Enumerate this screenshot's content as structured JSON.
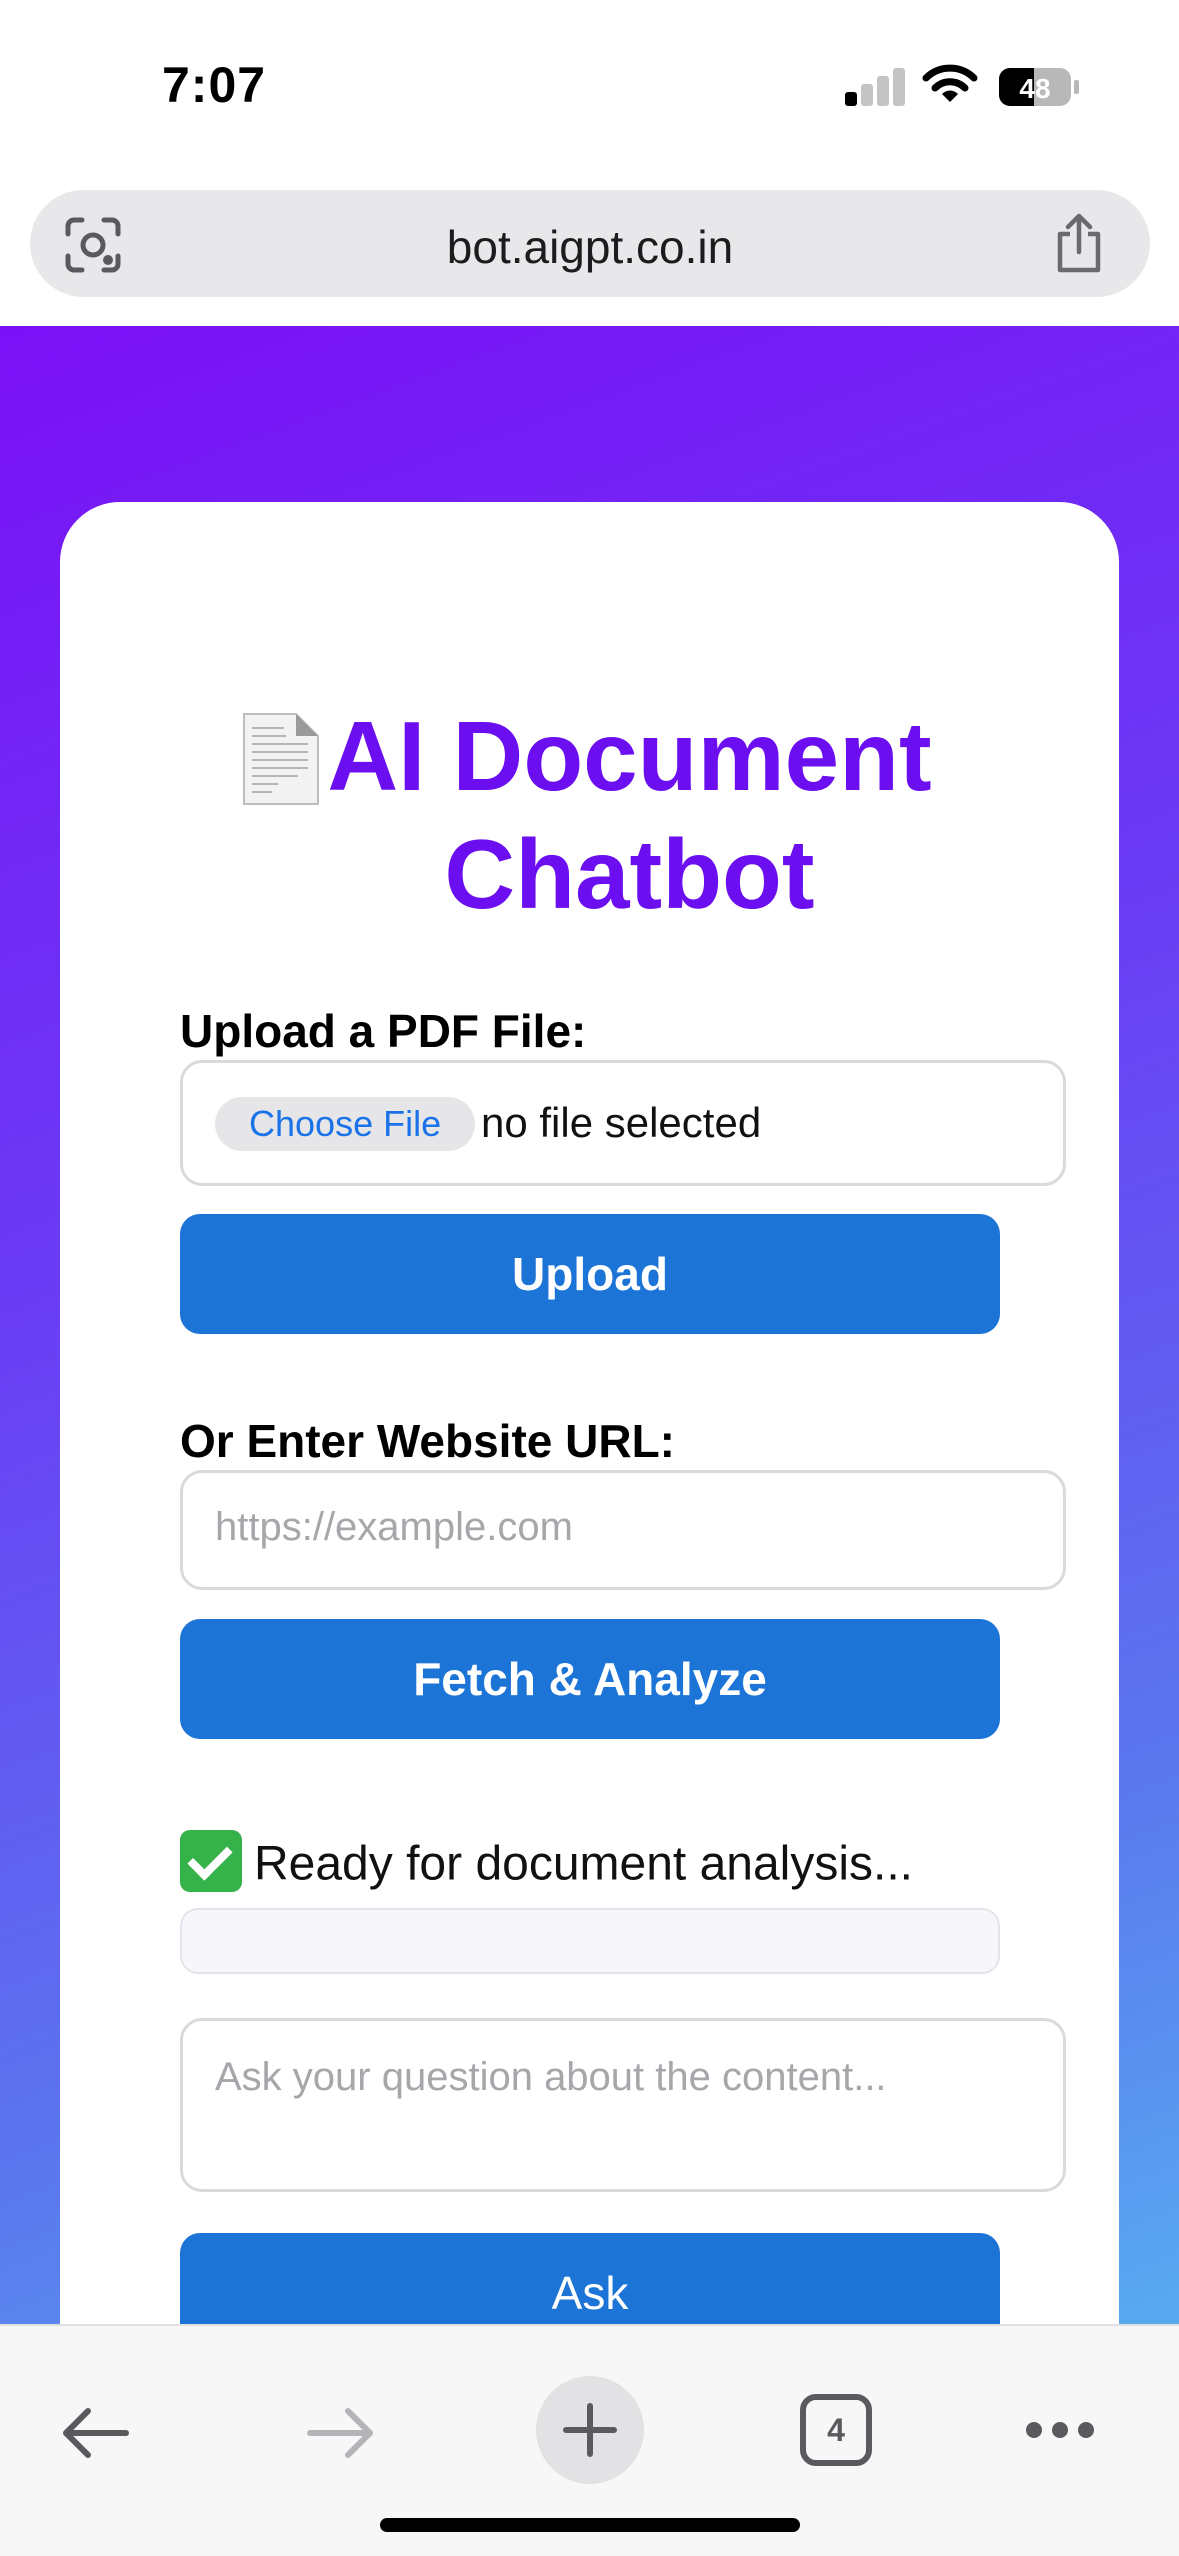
{
  "status_bar": {
    "time": "7:07",
    "battery": "48"
  },
  "browser": {
    "url": "bot.aigpt.co.in",
    "tab_count": "4"
  },
  "app": {
    "title": "AI Document Chatbot",
    "upload_label": "Upload a PDF File:",
    "choose_file": "Choose File",
    "file_status": "no file selected",
    "upload_button": "Upload",
    "url_label": "Or Enter Website URL:",
    "url_placeholder": "https://example.com",
    "fetch_button": "Fetch & Analyze",
    "status_text": "Ready for document analysis...",
    "question_placeholder": "Ask your question about the content...",
    "ask_button": "Ask"
  },
  "colors": {
    "accent_title": "#6b0ef0",
    "button": "#1b74d6",
    "gradient_start": "#7a10f6",
    "gradient_end": "#58aaf0"
  },
  "icons": [
    "lens-icon",
    "share-icon",
    "document-emoji-icon",
    "checkmark-icon",
    "back-arrow-icon",
    "forward-arrow-icon",
    "plus-icon",
    "tabs-icon",
    "more-icon"
  ]
}
